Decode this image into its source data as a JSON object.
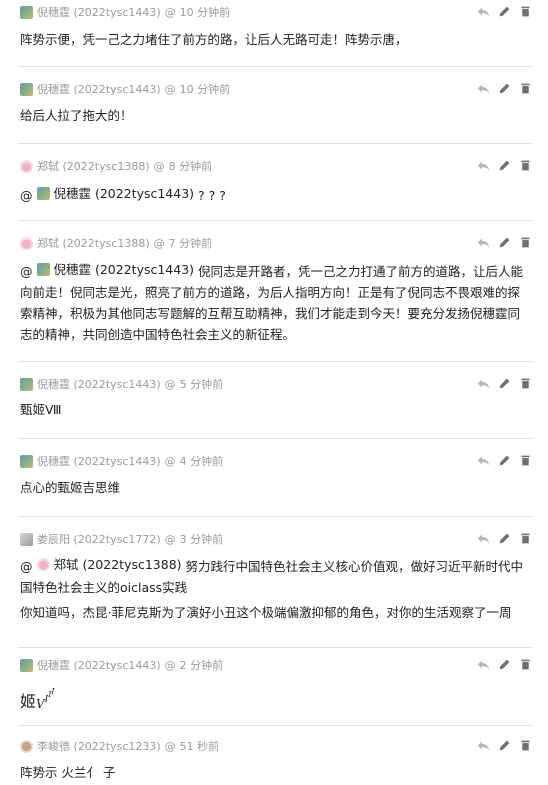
{
  "comments": [
    {
      "author": "倪穗霆 (2022tysc1443)",
      "time": "10 分钟前",
      "text": "阵势示便，凭一己之力堵住了前方的路，让后人无路可走！阵势示唐，"
    },
    {
      "author": "倪穗霆 (2022tysc1443)",
      "time": "10 分钟前",
      "text": "给后人拉了拖大的！"
    },
    {
      "author": "郑轼 (2022tysc1388)",
      "time": "8 分钟前",
      "mention": "倪穗霆 (2022tysc1443)",
      "text": "? ? ?"
    },
    {
      "author": "郑轼 (2022tysc1388)",
      "time": "7 分钟前",
      "mention": "倪穗霆 (2022tysc1443)",
      "text": "倪同志是开路者，凭一己之力打通了前方的道路，让后人能向前走！倪同志是光，照亮了前方的道路，为后人指明方向！正是有了倪同志不畏艰难的探索精神，积极为其他同志写题解的互帮互助精神，我们才能走到今天！要充分发扬倪穗霆同志的精神，共同创造中国特色社会主义的新征程。"
    },
    {
      "author": "倪穗霆 (2022tysc1443)",
      "time": "5 分钟前",
      "text": "甄姬Ⅷ"
    },
    {
      "author": "倪穗霆 (2022tysc1443)",
      "time": "4 分钟前",
      "text": "点心的甄姬吉思维"
    },
    {
      "author": "娄辰阳 (2022tysc1772)",
      "time": "3 分钟前",
      "mention": "郑轼 (2022tysc1388)",
      "text": "努力践行中国特色社会主义核心价值观，做好习近平新时代中国特色社会主义的oiclass实践",
      "text2": "你知道吗，杰昆·菲尼克斯为了演好小丑这个极端偏激抑郁的角色，对你的生活观察了一周"
    },
    {
      "author": "倪穗霆 (2022tysc1443)",
      "time": "2 分钟前",
      "text": "姬",
      "math": [
        "V",
        "I",
        "I",
        "I"
      ]
    },
    {
      "author": "李峻德 (2022tysc1233)",
      "time": "51 秒前",
      "text": "阵势示 火兰亻 子"
    }
  ],
  "at_symbol": "@",
  "time_prefix": "@",
  "icons": [
    "reply-icon",
    "edit-icon",
    "delete-icon"
  ]
}
